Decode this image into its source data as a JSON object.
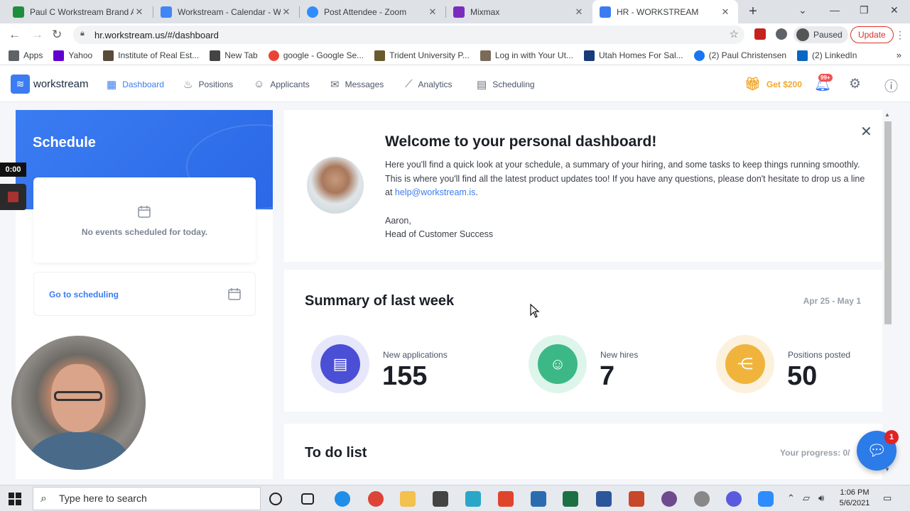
{
  "browser": {
    "tabs": [
      {
        "title": "Paul C Workstream Brand Ac",
        "color": "#1e8e3e"
      },
      {
        "title": "Workstream - Calendar - We",
        "color": "#4285f4"
      },
      {
        "title": "Post Attendee - Zoom",
        "color": "#2d8cff"
      },
      {
        "title": "Mixmax",
        "color": "#7b2cbf"
      },
      {
        "title": "HR - WORKSTREAM",
        "color": "#3b7cf2"
      }
    ],
    "url": "hr.workstream.us/#/dashboard",
    "profile_status": "Paused",
    "update_label": "Update",
    "bookmarks": [
      {
        "label": "Apps",
        "color": "#5f6368"
      },
      {
        "label": "Yahoo",
        "color": "#6001d2"
      },
      {
        "label": "Institute of Real Est...",
        "color": "#5a4a3a"
      },
      {
        "label": "New Tab",
        "color": "#444"
      },
      {
        "label": "google - Google Se...",
        "color": "#ea4335"
      },
      {
        "label": "Trident University P...",
        "color": "#6b5a2a"
      },
      {
        "label": "Log in with Your Ut...",
        "color": "#7a6a5a"
      },
      {
        "label": "Utah Homes For Sal...",
        "color": "#1a3a7a"
      },
      {
        "label": "(2) Paul Christensen",
        "color": "#1877f2"
      },
      {
        "label": "(2) LinkedIn",
        "color": "#0a66c2"
      }
    ]
  },
  "app": {
    "logo": "workstream",
    "nav": [
      {
        "label": "Dashboard",
        "icon": "grid-icon"
      },
      {
        "label": "Positions",
        "icon": "flame-icon"
      },
      {
        "label": "Applicants",
        "icon": "person-icon"
      },
      {
        "label": "Messages",
        "icon": "chat-icon",
        "badge": "99"
      },
      {
        "label": "Analytics",
        "icon": "chart-icon"
      },
      {
        "label": "Scheduling",
        "icon": "calendar-icon"
      }
    ],
    "get_reward": "Get $200",
    "notif_badge": "99+",
    "accent": "#3b7cf2"
  },
  "schedule": {
    "title": "Schedule",
    "empty_text": "No events scheduled for today.",
    "goto_label": "Go to scheduling"
  },
  "recording": {
    "timer": "0:00"
  },
  "welcome": {
    "title": "Welcome to your personal dashboard!",
    "body_before_link": "Here you'll find a quick look at your schedule, a summary of your hiring, and some tasks to keep things running smoothly. This is where you'll find all the latest product updates too! If you have any questions, please don't hesitate to drop us a line at ",
    "email": "help@workstream.is",
    "body_after_link": ".",
    "signoff_name": "Aaron,",
    "signoff_role": "Head of Customer Success"
  },
  "summary": {
    "title": "Summary of last week",
    "date_range": "Apr 25 - May 1",
    "stats": [
      {
        "label": "New applications",
        "value": "155",
        "color": "#4b4fd6",
        "ring": "#e6e7fb"
      },
      {
        "label": "New hires",
        "value": "7",
        "color": "#3cb886",
        "ring": "#def5ec"
      },
      {
        "label": "Positions posted",
        "value": "50",
        "color": "#f0b43c",
        "ring": "#fcf1dc"
      }
    ]
  },
  "todo": {
    "title": "To do list",
    "progress": "Your progress: 0/"
  },
  "chat": {
    "badge": "1"
  },
  "taskbar": {
    "search_placeholder": "Type here to search",
    "time": "1:06 PM",
    "date": "5/6/2021",
    "apps": [
      {
        "name": "cortana-icon",
        "color": "#ffffff"
      },
      {
        "name": "task-view-icon",
        "color": "#ffffff"
      },
      {
        "name": "edge-icon",
        "color": "#1f8ee8"
      },
      {
        "name": "chrome-icon",
        "color": "#db4437"
      },
      {
        "name": "file-explorer-icon",
        "color": "#f2c14e"
      },
      {
        "name": "store-icon",
        "color": "#444444"
      },
      {
        "name": "l-app-icon",
        "color": "#2aa6c8"
      },
      {
        "name": "red-app-icon",
        "color": "#e0442c"
      },
      {
        "name": "mail-icon",
        "color": "#2b6cb0"
      },
      {
        "name": "excel-icon",
        "color": "#1d7044"
      },
      {
        "name": "word-icon",
        "color": "#2b579a"
      },
      {
        "name": "powerpoint-icon",
        "color": "#c8462a"
      },
      {
        "name": "slack-icon",
        "color": "#6f4a8e"
      },
      {
        "name": "app-icon",
        "color": "#888888"
      },
      {
        "name": "gear-app-icon",
        "color": "#5a5adf"
      },
      {
        "name": "zoom-icon",
        "color": "#2d8cff"
      }
    ]
  }
}
